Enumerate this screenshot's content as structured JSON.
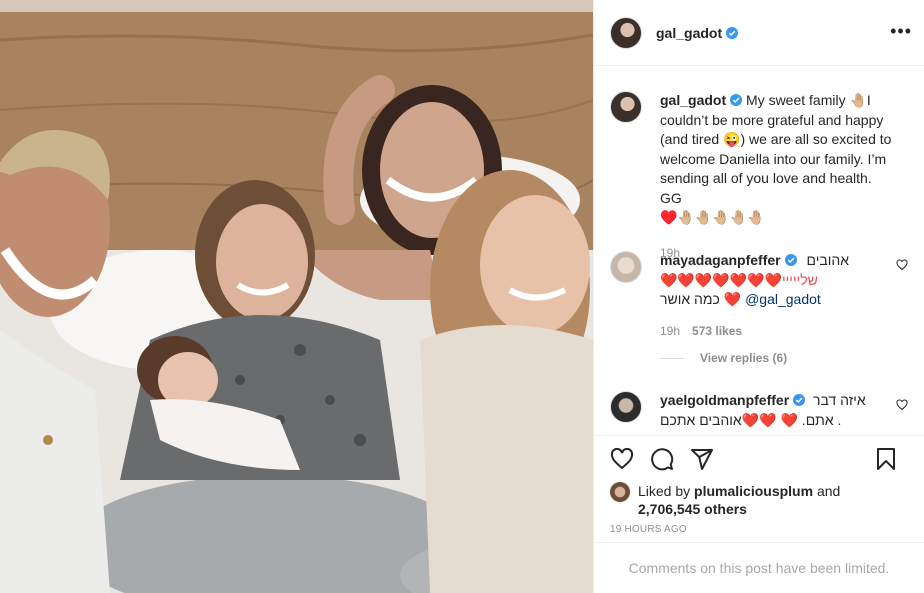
{
  "post": {
    "username": "gal_gadot",
    "verified": true,
    "more_icon": "ellipsis-icon"
  },
  "caption": {
    "username": "gal_gadot",
    "text_line1": "My sweet family 🤚🏼I couldn’t be more grateful and happy (and tired 😜) we are all so excited to welcome Daniella into our family. I’m sending all of you love and health. GG",
    "text_line2": "♥️🤚🏼🤚🏼🤚🏼🤚🏼🤚🏼",
    "time": "19h"
  },
  "comments": [
    {
      "username": "mayadaganpfeffer",
      "rtl_line1": "אהובים",
      "rtl_line2": "❤️❤️❤️❤️❤️❤️❤️שלייייי",
      "rtl_line3": "כמה אושר ❤️",
      "mention": "@gal_gadot",
      "time": "19h",
      "likes": "573 likes",
      "view_replies": "View replies (6)"
    },
    {
      "username": "yaelgoldmanpfeffer",
      "rtl_line1": "איזה דבר",
      "rtl_line2": "אתם. ❤️ ❤️❤️אוהבים אתכם ."
    }
  ],
  "actions": {
    "liked_by_prefix": "Liked by",
    "liked_by_user": "plumaliciousplum",
    "liked_by_and": "and",
    "others": "2,706,545 others",
    "timestamp": "19 HOURS AGO",
    "icons": [
      "heart-icon",
      "comment-icon",
      "share-icon",
      "bookmark-icon"
    ]
  },
  "footer": {
    "limited": "Comments on this post have been limited."
  },
  "colors": {
    "verified": "#3897f0",
    "heart_red": "#ed4956",
    "muted": "#8e8e8e",
    "link": "#00376b"
  }
}
